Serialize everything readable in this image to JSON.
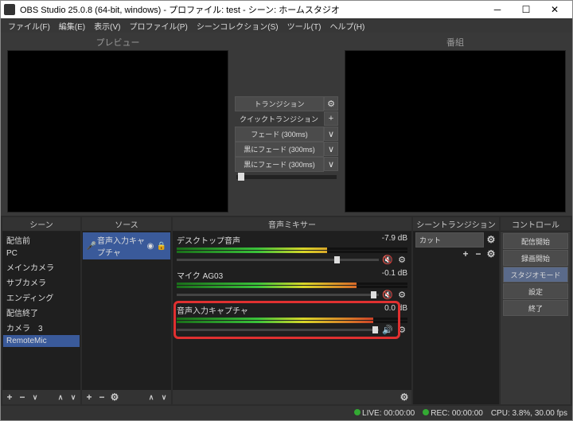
{
  "window": {
    "title": "OBS Studio 25.0.8 (64-bit, windows) - プロファイル: test - シーン: ホームスタジオ"
  },
  "menu": {
    "file": "ファイル(F)",
    "edit": "編集(E)",
    "view": "表示(V)",
    "profile": "プロファイル(P)",
    "scenecol": "シーンコレクション(S)",
    "tools": "ツール(T)",
    "help": "ヘルプ(H)"
  },
  "preview": {
    "left": "プレビュー",
    "right": "番組"
  },
  "transition": {
    "label": "トランジション",
    "quick": "クイックトランジション",
    "fade": "フェード (300ms)",
    "blackfade1": "黒にフェード (300ms)",
    "blackfade2": "黒にフェード (300ms)"
  },
  "docks": {
    "scenes": "シーン",
    "sources": "ソース",
    "mixer": "音声ミキサー",
    "strans": "シーントランジション",
    "controls": "コントロール"
  },
  "scenes": {
    "items": [
      "配信前",
      "PC",
      "メインカメラ",
      "サブカメラ",
      "エンディング",
      "配信終了",
      "カメラ　3",
      "RemoteMic"
    ]
  },
  "sources": {
    "item": "音声入力キャプチャ"
  },
  "mixer": {
    "ch1": {
      "name": "デスクトップ音声",
      "db": "-7.9 dB"
    },
    "ch2": {
      "name": "マイク AG03",
      "db": "-0.1 dB"
    },
    "ch3": {
      "name": "音声入力キャプチャ",
      "db": "0.0 dB"
    }
  },
  "strans": {
    "cut": "カット"
  },
  "controls": {
    "start_stream": "配信開始",
    "start_record": "録画開始",
    "studio_mode": "スタジオモード",
    "settings": "設定",
    "exit": "終了"
  },
  "status": {
    "live": "LIVE: 00:00:00",
    "rec": "REC: 00:00:00",
    "cpu": "CPU: 3.8%, 30.00 fps"
  },
  "icons": {
    "plus": "+",
    "minus": "−",
    "gear": "⚙",
    "chevron": "∨",
    "up": "∧",
    "down": "∨",
    "eye": "◉",
    "lock": "🔒",
    "speaker": "🔊",
    "muted": "🔇"
  }
}
